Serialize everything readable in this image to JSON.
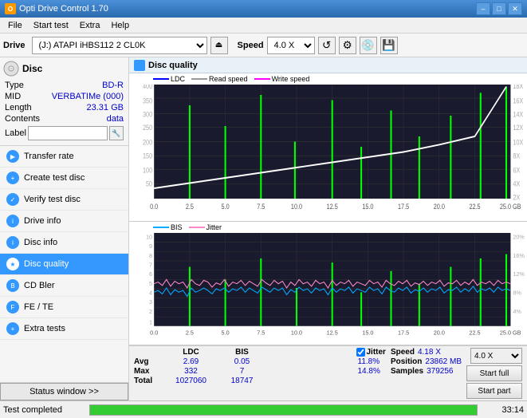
{
  "titlebar": {
    "title": "Opti Drive Control 1.70",
    "min_label": "–",
    "max_label": "□",
    "close_label": "✕"
  },
  "menu": {
    "items": [
      "File",
      "Start test",
      "Extra",
      "Help"
    ]
  },
  "toolbar": {
    "drive_label": "Drive",
    "drive_value": "(J:) ATAPI iHBS112  2 CL0K",
    "speed_label": "Speed",
    "speed_value": "4.0 X"
  },
  "disc": {
    "title": "Disc",
    "type_label": "Type",
    "type_value": "BD-R",
    "mid_label": "MID",
    "mid_value": "VERBATIMe (000)",
    "length_label": "Length",
    "length_value": "23.31 GB",
    "contents_label": "Contents",
    "contents_value": "data",
    "label_label": "Label",
    "label_value": ""
  },
  "nav": {
    "items": [
      {
        "label": "Transfer rate",
        "active": false
      },
      {
        "label": "Create test disc",
        "active": false
      },
      {
        "label": "Verify test disc",
        "active": false
      },
      {
        "label": "Drive info",
        "active": false
      },
      {
        "label": "Disc info",
        "active": false
      },
      {
        "label": "Disc quality",
        "active": true
      },
      {
        "label": "CD Bler",
        "active": false
      },
      {
        "label": "FE / TE",
        "active": false
      },
      {
        "label": "Extra tests",
        "active": false
      }
    ]
  },
  "status_btn": "Status window >>",
  "content": {
    "title": "Disc quality"
  },
  "chart_top": {
    "legend": {
      "ldc": "LDC",
      "read": "Read speed",
      "write": "Write speed"
    },
    "y_max": 400,
    "y_right_labels": [
      "18X",
      "16X",
      "14X",
      "12X",
      "10X",
      "8X",
      "6X",
      "4X",
      "2X"
    ],
    "x_labels": [
      "0.0",
      "2.5",
      "5.0",
      "7.5",
      "10.0",
      "12.5",
      "15.0",
      "17.5",
      "20.0",
      "22.5",
      "25.0 GB"
    ]
  },
  "chart_bottom": {
    "legend": {
      "bis": "BIS",
      "jitter": "Jitter"
    },
    "y_labels_left": [
      "10",
      "9",
      "8",
      "7",
      "6",
      "5",
      "4",
      "3",
      "2",
      "1"
    ],
    "y_labels_right": [
      "20%",
      "16%",
      "12%",
      "8%",
      "4%"
    ],
    "x_labels": [
      "0.0",
      "2.5",
      "5.0",
      "7.5",
      "10.0",
      "12.5",
      "15.0",
      "17.5",
      "20.0",
      "22.5",
      "25.0 GB"
    ]
  },
  "stats": {
    "col_ldc": "LDC",
    "col_bis": "BIS",
    "jitter_label": "Jitter",
    "speed_label": "Speed",
    "position_label": "Position",
    "samples_label": "Samples",
    "avg_label": "Avg",
    "max_label": "Max",
    "total_label": "Total",
    "avg_ldc": "2.69",
    "avg_bis": "0.05",
    "avg_jitter": "11.8%",
    "max_ldc": "332",
    "max_bis": "7",
    "max_jitter": "14.8%",
    "total_ldc": "1027060",
    "total_bis": "18747",
    "speed_value": "4.18 X",
    "speed_select": "4.0 X",
    "position_value": "23862 MB",
    "samples_value": "379256",
    "btn_full": "Start full",
    "btn_part": "Start part"
  },
  "bottom_status": {
    "text": "Test completed",
    "progress": 100,
    "time": "33:14"
  }
}
